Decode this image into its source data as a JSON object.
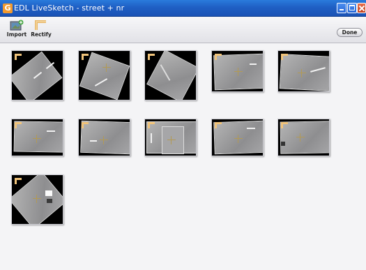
{
  "window": {
    "title": "EDL LiveSketch - street + nr",
    "app_icon": "G",
    "controls": [
      "minimize-icon",
      "maximize-icon",
      "close-icon"
    ]
  },
  "toolbar": {
    "import_label": "Import",
    "import_icon": "import-image-icon",
    "rectify_label": "Rectify",
    "rectify_icon": "rectify-corner-icon",
    "done_label": "Done"
  },
  "thumbnails": {
    "count": 11,
    "marker_color": "#f0c37a",
    "background": "#000000"
  }
}
